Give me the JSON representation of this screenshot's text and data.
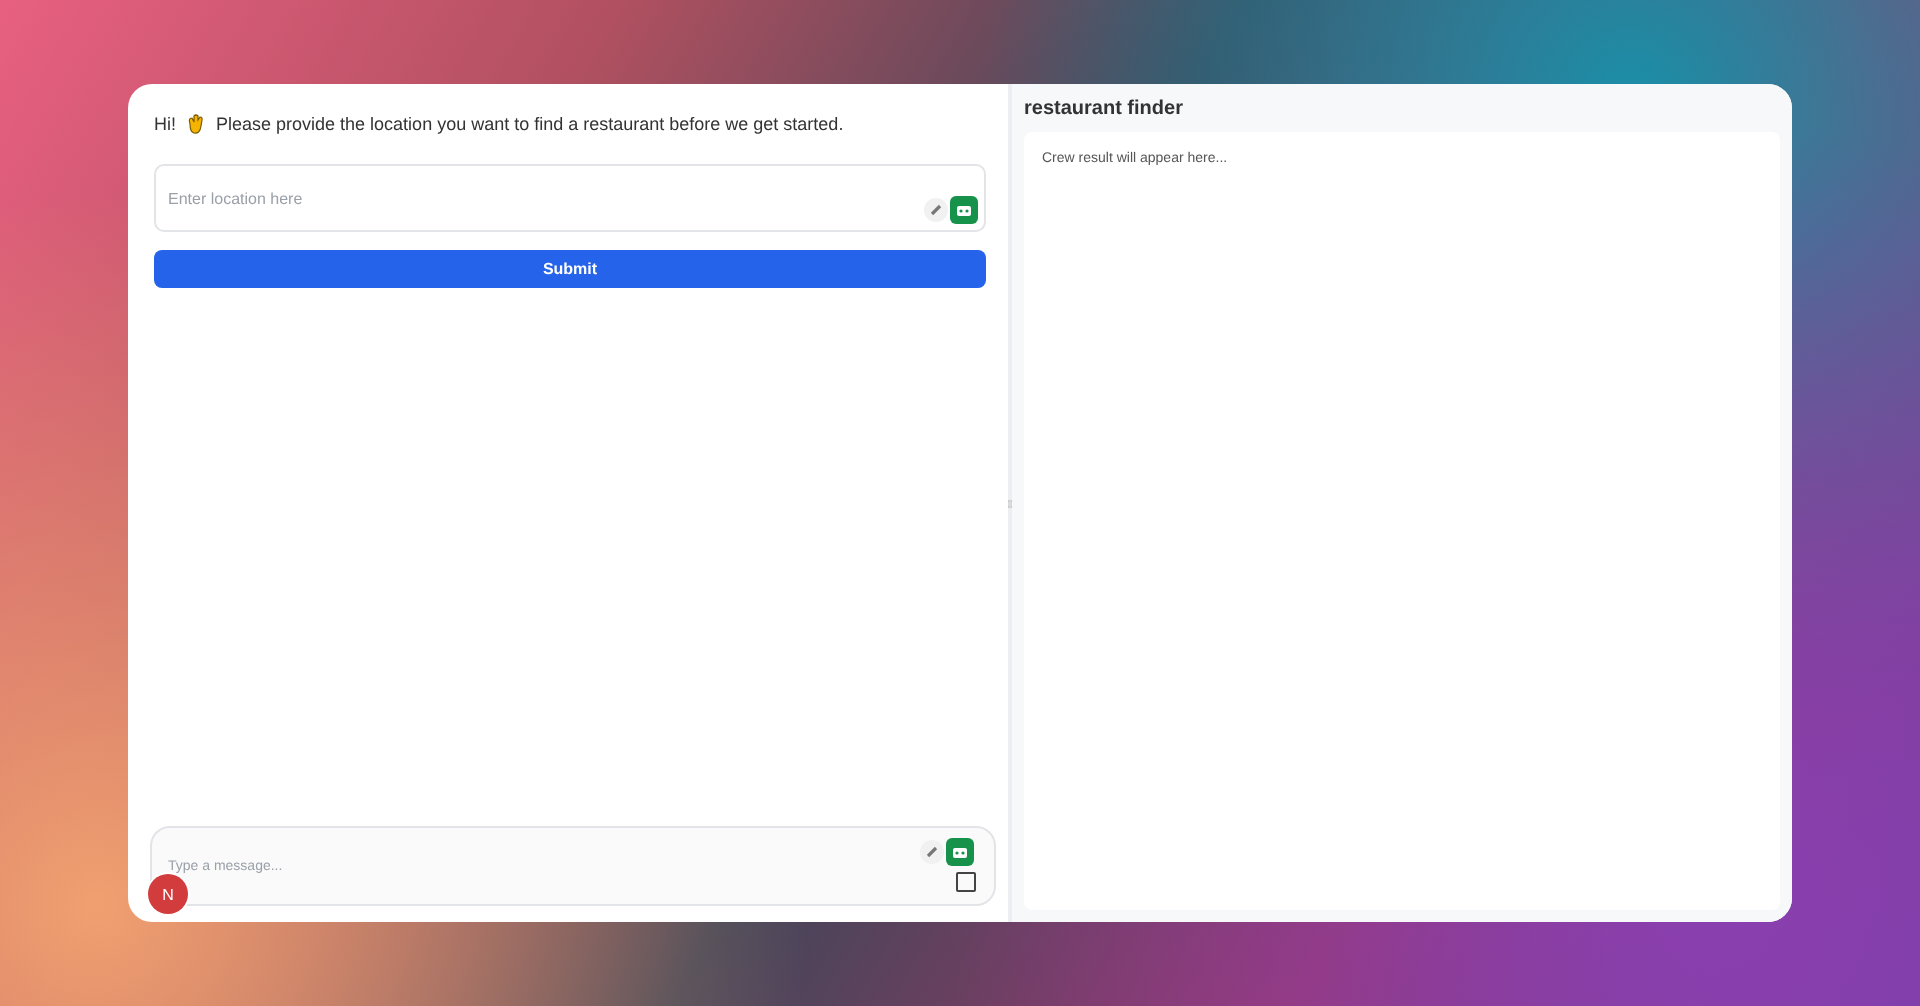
{
  "chat": {
    "greeting": "Hi!",
    "message": "Please provide the location you want to find a restaurant before we get started.",
    "location_field": {
      "placeholder": "Enter location here"
    },
    "submit_button": "Submit",
    "composer": {
      "placeholder": "Type a message...",
      "checkbox": {
        "checked": false
      }
    },
    "avatar": {
      "initial": "N"
    }
  },
  "result_panel": {
    "title": "restaurant finder",
    "placeholder_text": "Crew result will appear here..."
  }
}
